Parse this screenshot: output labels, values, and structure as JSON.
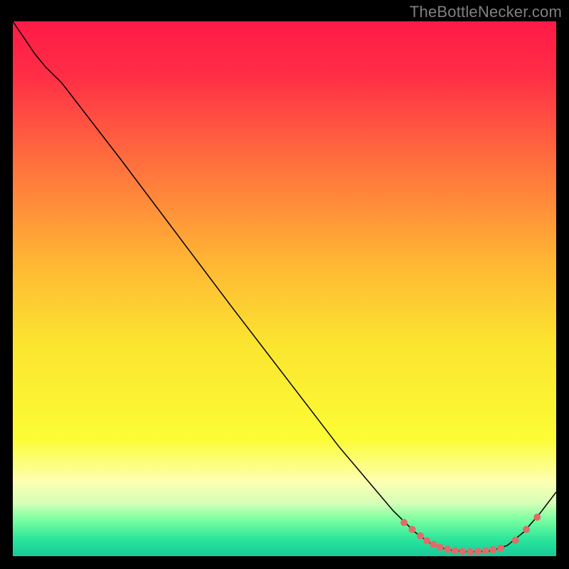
{
  "attribution": "TheBottleNecker.com",
  "chart_data": {
    "type": "line",
    "title": "",
    "xlabel": "",
    "ylabel": "",
    "xlim": [
      0,
      100
    ],
    "ylim": [
      0,
      100
    ],
    "background_gradient": {
      "stops": [
        {
          "offset": 0.0,
          "color": "#ff1a47"
        },
        {
          "offset": 0.1,
          "color": "#ff2d46"
        },
        {
          "offset": 0.25,
          "color": "#ff6a3e"
        },
        {
          "offset": 0.45,
          "color": "#ffb634"
        },
        {
          "offset": 0.6,
          "color": "#fbe42f"
        },
        {
          "offset": 0.78,
          "color": "#fcfc35"
        },
        {
          "offset": 0.86,
          "color": "#fdffb2"
        },
        {
          "offset": 0.9,
          "color": "#d7ffb7"
        },
        {
          "offset": 0.93,
          "color": "#7effa2"
        },
        {
          "offset": 0.97,
          "color": "#28e49a"
        },
        {
          "offset": 1.0,
          "color": "#19c99a"
        }
      ]
    },
    "series": [
      {
        "name": "bottleneck-curve",
        "stroke": "#000000",
        "stroke_width": 1.5,
        "points": [
          {
            "x": 0.0,
            "y": 100.0
          },
          {
            "x": 4.0,
            "y": 94.0
          },
          {
            "x": 6.0,
            "y": 91.5
          },
          {
            "x": 9.0,
            "y": 88.5
          },
          {
            "x": 20.0,
            "y": 74.0
          },
          {
            "x": 40.0,
            "y": 47.0
          },
          {
            "x": 60.0,
            "y": 20.5
          },
          {
            "x": 70.0,
            "y": 8.5
          },
          {
            "x": 74.0,
            "y": 4.5
          },
          {
            "x": 77.0,
            "y": 2.3
          },
          {
            "x": 80.0,
            "y": 1.2
          },
          {
            "x": 84.0,
            "y": 0.8
          },
          {
            "x": 88.0,
            "y": 1.0
          },
          {
            "x": 91.0,
            "y": 2.0
          },
          {
            "x": 94.0,
            "y": 4.5
          },
          {
            "x": 97.0,
            "y": 8.0
          },
          {
            "x": 100.0,
            "y": 12.0
          }
        ]
      }
    ],
    "markers": {
      "color": "#e26a6a",
      "radius": 5,
      "points": [
        {
          "x": 72.0,
          "y": 6.3
        },
        {
          "x": 73.5,
          "y": 5.0
        },
        {
          "x": 75.0,
          "y": 3.8
        },
        {
          "x": 76.2,
          "y": 2.9
        },
        {
          "x": 77.4,
          "y": 2.2
        },
        {
          "x": 78.6,
          "y": 1.7
        },
        {
          "x": 80.0,
          "y": 1.3
        },
        {
          "x": 81.4,
          "y": 1.0
        },
        {
          "x": 82.8,
          "y": 0.9
        },
        {
          "x": 84.2,
          "y": 0.85
        },
        {
          "x": 85.6,
          "y": 0.9
        },
        {
          "x": 87.0,
          "y": 1.0
        },
        {
          "x": 88.4,
          "y": 1.2
        },
        {
          "x": 89.8,
          "y": 1.5
        },
        {
          "x": 92.5,
          "y": 3.0
        },
        {
          "x": 94.5,
          "y": 5.0
        },
        {
          "x": 96.5,
          "y": 7.3
        }
      ]
    }
  }
}
